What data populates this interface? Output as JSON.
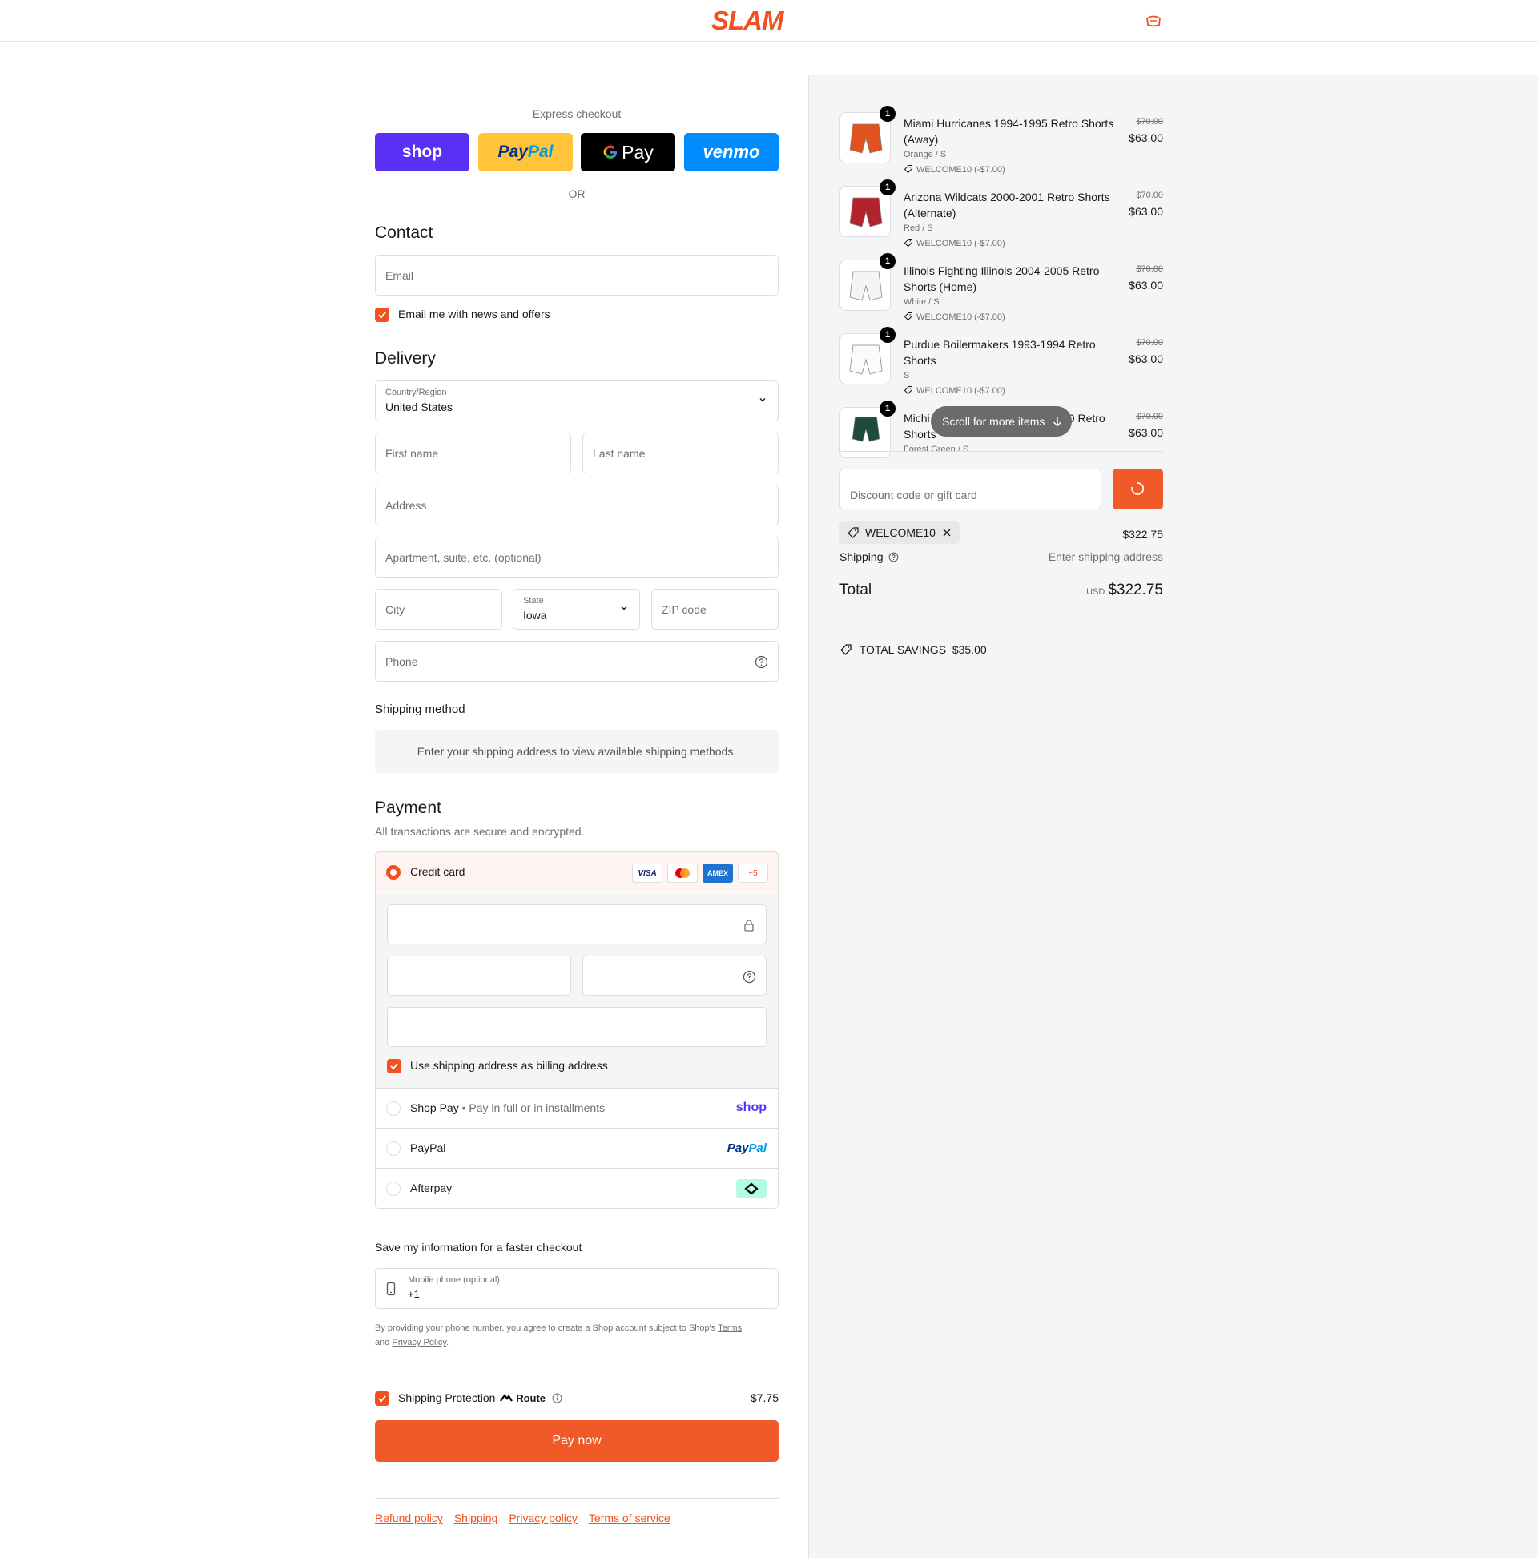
{
  "header": {
    "logo_text": "SLAM"
  },
  "express": {
    "label": "Express checkout",
    "buttons": [
      {
        "label": "shop"
      },
      {
        "label_a": "Pay",
        "label_b": "Pal"
      },
      {
        "label": "Pay"
      },
      {
        "label": "venmo"
      }
    ],
    "or": "OR"
  },
  "contact": {
    "heading": "Contact",
    "email_placeholder": "Email",
    "news_label": "Email me with news and offers"
  },
  "delivery": {
    "heading": "Delivery",
    "country_label": "Country/Region",
    "country_value": "United States",
    "first_name": "First name",
    "last_name": "Last name",
    "address": "Address",
    "apartment": "Apartment, suite, etc. (optional)",
    "city": "City",
    "state_label": "State",
    "state_value": "Iowa",
    "zip": "ZIP code",
    "phone": "Phone"
  },
  "shipping_method": {
    "heading": "Shipping method",
    "note": "Enter your shipping address to view available shipping methods."
  },
  "payment": {
    "heading": "Payment",
    "subtitle": "All transactions are secure and encrypted.",
    "credit_card": "Credit card",
    "card_badges": [
      "VISA",
      "",
      "AMEX",
      "+5"
    ],
    "billing_label": "Use shipping address as billing address",
    "shop_pay": "Shop Pay",
    "shop_pay_sub": "Pay in full or in installments",
    "shop_pay_logo": "shop",
    "paypal": "PayPal",
    "paypal_logo_a": "Pay",
    "paypal_logo_b": "Pal",
    "afterpay": "Afterpay"
  },
  "save_info": {
    "heading": "Save my information for a faster checkout",
    "mobile_label": "Mobile phone (optional)",
    "mobile_value": "+1",
    "terms_1": "By providing your phone number, you agree to create a Shop account subject to Shop's ",
    "terms_link": "Terms",
    "terms_2": "and ",
    "privacy_link": "Privacy Policy",
    "terms_3": "."
  },
  "protection": {
    "label": "Shipping Protection",
    "brand": "Route",
    "price": "$7.75"
  },
  "pay_now": "Pay now",
  "footer": {
    "links": [
      "Refund policy",
      "Shipping",
      "Privacy policy",
      "Terms of service"
    ]
  },
  "cart": {
    "items": [
      {
        "qty": "1",
        "title": "Miami Hurricanes 1994-1995 Retro Shorts (Away)",
        "variant": "Orange / S",
        "discount": "WELCOME10 (-$7.00)",
        "orig": "$70.00",
        "price": "$63.00",
        "color": "#e0521f"
      },
      {
        "qty": "1",
        "title": "Arizona Wildcats 2000-2001 Retro Shorts (Alternate)",
        "variant": "Red / S",
        "discount": "WELCOME10 (-$7.00)",
        "orig": "$70.00",
        "price": "$63.00",
        "color": "#b3232b"
      },
      {
        "qty": "1",
        "title": "Illinois Fighting Illinois 2004-2005 Retro Shorts (Home)",
        "variant": "White / S",
        "discount": "WELCOME10 (-$7.00)",
        "orig": "$70.00",
        "price": "$63.00",
        "color": "#f4f4f4"
      },
      {
        "qty": "1",
        "title": "Purdue Boilermakers 1993-1994 Retro Shorts",
        "variant": "S",
        "discount": "WELCOME10 (-$7.00)",
        "orig": "$70.00",
        "price": "$63.00",
        "color": "#fbfbfb"
      },
      {
        "qty": "1",
        "title": "Michigan State Spartans 1999-2000 Retro Shorts",
        "title_visible_a": "Michi",
        "title_visible_b": "00 Retro",
        "title_visible_c": "Shorts",
        "variant": "Forest Green / S",
        "orig": "$70.00",
        "price": "$63.00",
        "color": "#1e4b3c"
      }
    ],
    "scroll_pill": "Scroll for more items",
    "discount_placeholder": "Discount code or gift card",
    "applied_code": "WELCOME10",
    "subtotal": "$322.75",
    "shipping_label": "Shipping",
    "shipping_value": "Enter shipping address",
    "total_label": "Total",
    "currency": "USD",
    "total": "$322.75",
    "savings_label": "TOTAL SAVINGS",
    "savings_value": "$35.00"
  },
  "colors": {
    "accent": "#f0511e",
    "shop": "#5a31f4",
    "paypal_bg": "#ffc439",
    "venmo": "#008cff"
  }
}
